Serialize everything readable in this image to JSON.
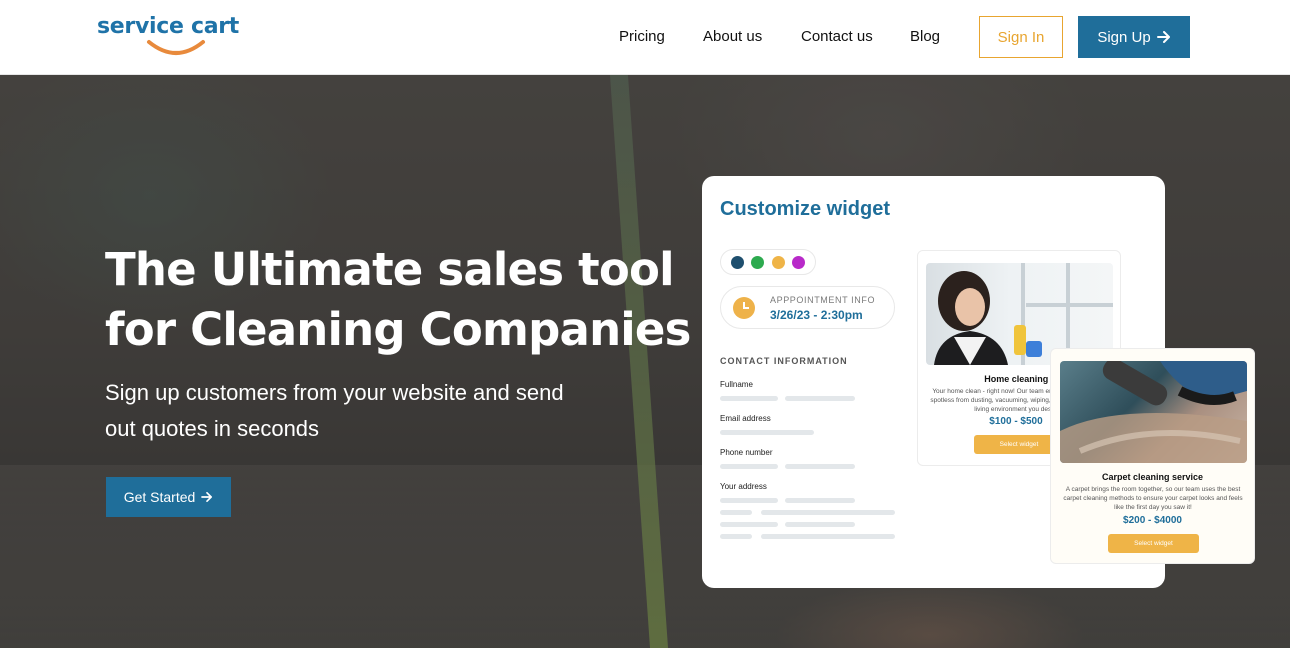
{
  "header": {
    "logo_text": "service cart",
    "nav": [
      "Pricing",
      "About us",
      "Contact us",
      "Blog"
    ],
    "signin_label": "Sign In",
    "signup_label": "Sign Up",
    "signup_icon": "arrow-right-icon"
  },
  "hero": {
    "title_line1": "The Ultimate sales tool",
    "title_line2": "for Cleaning Companies",
    "subtitle_line1": "Sign up customers from your website and send",
    "subtitle_line2": "out quotes in seconds",
    "cta_label": "Get Started"
  },
  "widget": {
    "title": "Customize widget",
    "color_options": [
      "#1f4f6e",
      "#2daa4f",
      "#efb447",
      "#b82ac9"
    ],
    "appointment_label": "APPPOINTMENT INFO",
    "appointment_value": "3/26/23 - 2:30pm",
    "contact_heading": "CONTACT INFORMATION",
    "fields": [
      "Fullname",
      "Email address",
      "Phone number",
      "Your address"
    ]
  },
  "services": [
    {
      "title": "Home cleaning service",
      "description": "Your home clean - right now! Our team ensures your home is spotless from dusting, vacuuming, wiping, mopping for a clean living environment you deserve.",
      "price": "$100 - $500",
      "button": "Select widget"
    },
    {
      "title": "Carpet cleaning service",
      "description": "A carpet brings the room together, so our team uses the best carpet cleaning methods to ensure your carpet looks and feels like the first day you saw it!",
      "price": "$200 - $4000",
      "button": "Select widget"
    }
  ],
  "colors": {
    "brand_blue": "#1f6e9a",
    "accent_orange": "#e8a530"
  }
}
